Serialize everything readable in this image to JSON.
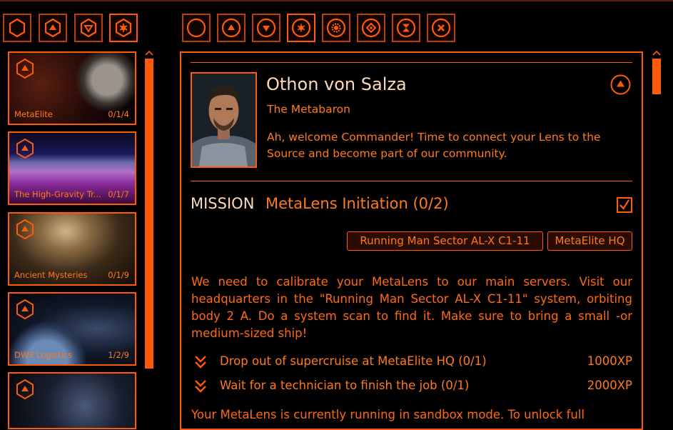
{
  "colors": {
    "accent": "#ff5a0a",
    "text": "#ff7a1a",
    "muted": "#b8400c",
    "background": "#000000"
  },
  "left_tabs": [
    {
      "icon": "hexagon-icon",
      "selected": false
    },
    {
      "icon": "chevron-up-hex-icon",
      "selected": false
    },
    {
      "icon": "chevron-down-hex-icon",
      "selected": false
    },
    {
      "icon": "star-hex-icon",
      "selected": true
    }
  ],
  "filter_tabs": [
    {
      "icon": "circle-icon",
      "selected": false
    },
    {
      "icon": "chevron-up-circle-icon",
      "selected": false
    },
    {
      "icon": "chevron-down-circle-icon",
      "selected": false
    },
    {
      "icon": "star-circle-icon",
      "selected": true
    },
    {
      "icon": "gear-circle-icon",
      "selected": false
    },
    {
      "icon": "diamond-circle-icon",
      "selected": false
    },
    {
      "icon": "hourglass-circle-icon",
      "selected": false
    },
    {
      "icon": "close-circle-icon",
      "selected": false
    }
  ],
  "campaigns": [
    {
      "title": "MetaElite",
      "count": "0/1/4"
    },
    {
      "title": "The High-Gravity Tr...",
      "count": "0/1/7"
    },
    {
      "title": "Ancient Mysteries",
      "count": "0/1/9"
    },
    {
      "title": "DW3 Logistics",
      "count": "1/2/9"
    },
    {
      "title": "",
      "count": ""
    }
  ],
  "npc": {
    "name": "Othon von Salza",
    "role": "The Metabaron",
    "greeting": "Ah, welcome Commander! Time to connect your Lens to the Source and become part of our community."
  },
  "mission": {
    "label": "MISSION",
    "title": "MetaLens Initiation (0/2)",
    "checked": true,
    "locations": [
      "Running Man Sector AL-X C1-11",
      "MetaElite HQ"
    ],
    "description": "We need to calibrate your MetaLens to our main servers. Visit our headquarters in the \"Running Man Sector AL-X C1-11\" system, orbiting body 2 A. Do a system scan to find it. Make sure to bring a small -or medium-sized ship!",
    "objectives": [
      {
        "text": "Drop out of supercruise at MetaElite HQ (0/1)",
        "xp": "1000XP",
        "icon": "double-chevron-down-icon"
      },
      {
        "text": "Wait for a technician to finish the job (0/1)",
        "xp": "2000XP",
        "icon": "double-chevron-down-icon"
      }
    ],
    "footer": "Your MetaLens is currently running in sandbox mode. To unlock full"
  }
}
